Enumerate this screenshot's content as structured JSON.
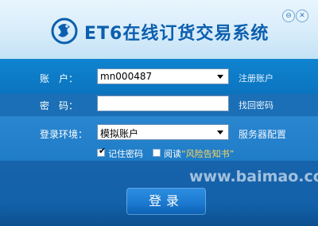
{
  "app": {
    "title": "ET6在线订货交易系统"
  },
  "window": {
    "min_glyph": "⊖",
    "close_glyph": "✕"
  },
  "form": {
    "account": {
      "label": "账　户：",
      "value": "mn000487",
      "link": "注册账户"
    },
    "password": {
      "label": "密　码：",
      "value": "",
      "link": "找回密码"
    },
    "environment": {
      "label": "登录环境：",
      "value": "模拟账户",
      "link": "服务器配置"
    },
    "remember": {
      "label": "记住密码",
      "checked": true
    },
    "agreement": {
      "prefix": "阅读",
      "link": "“风险告知书”",
      "checked": false
    }
  },
  "login_button": {
    "label": "登录"
  },
  "watermark": "www.baimao.com",
  "colors": {
    "accent": "#0c5fae",
    "button": "#1576cc"
  }
}
